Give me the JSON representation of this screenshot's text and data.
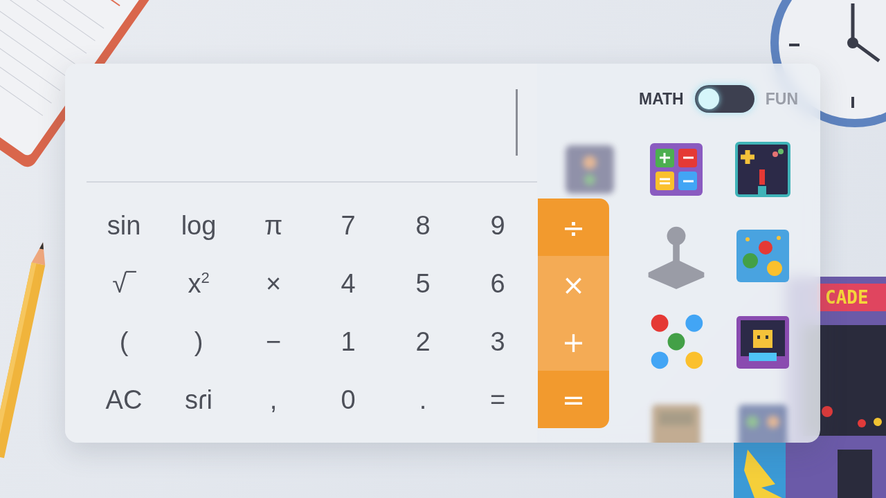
{
  "calculator": {
    "keys": [
      {
        "label": "sin"
      },
      {
        "label": "log"
      },
      {
        "label": "π"
      },
      {
        "label": "7"
      },
      {
        "label": "8"
      },
      {
        "label": "9"
      },
      {
        "label": "√‾"
      },
      {
        "label": "x$^{2}$"
      },
      {
        "label": "×"
      },
      {
        "label": "4"
      },
      {
        "label": "5"
      },
      {
        "label": "6"
      },
      {
        "label": "("
      },
      {
        "label": ")"
      },
      {
        "label": "−"
      },
      {
        "label": "1"
      },
      {
        "label": "2"
      },
      {
        "label": "3"
      },
      {
        "label": "AC"
      },
      {
        "label": "sɾi"
      },
      {
        "label": ","
      },
      {
        "label": "0"
      },
      {
        "label": "."
      },
      {
        "label": "="
      }
    ],
    "operators": [
      {
        "label": "÷",
        "highlighted": false
      },
      {
        "label": "×",
        "highlighted": true
      },
      {
        "label": "+",
        "highlighted": true
      },
      {
        "label": "=",
        "highlighted": false
      }
    ]
  },
  "mode_toggle": {
    "left_label": "MATH",
    "right_label": "FUN",
    "on": false
  },
  "background": {
    "arcade_marquee": "CADE"
  }
}
